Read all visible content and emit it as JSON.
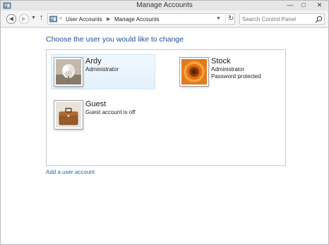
{
  "window": {
    "title": "Manage Accounts"
  },
  "navigation": {
    "back_icon": "back-arrow-icon",
    "forward_icon": "forward-arrow-icon",
    "up_icon": "up-arrow-icon",
    "address": {
      "overflow": "«",
      "crumbs": [
        "User Accounts",
        "Manage Accounts"
      ]
    },
    "search": {
      "placeholder": "Search Control Panel"
    }
  },
  "main": {
    "heading": "Choose the user you would like to change",
    "users": [
      {
        "name": "Ardy",
        "details": [
          "Administrator"
        ],
        "selected": true
      },
      {
        "name": "Stock",
        "details": [
          "Administrator",
          "Password protected"
        ],
        "selected": false
      },
      {
        "name": "Guest",
        "details": [
          "Guest account is off"
        ],
        "selected": false
      }
    ],
    "add_user_link": "Add a user account"
  },
  "colors": {
    "heading": "#1e4e9c",
    "link": "#1e62b8",
    "selection": "#e3f1fc"
  }
}
